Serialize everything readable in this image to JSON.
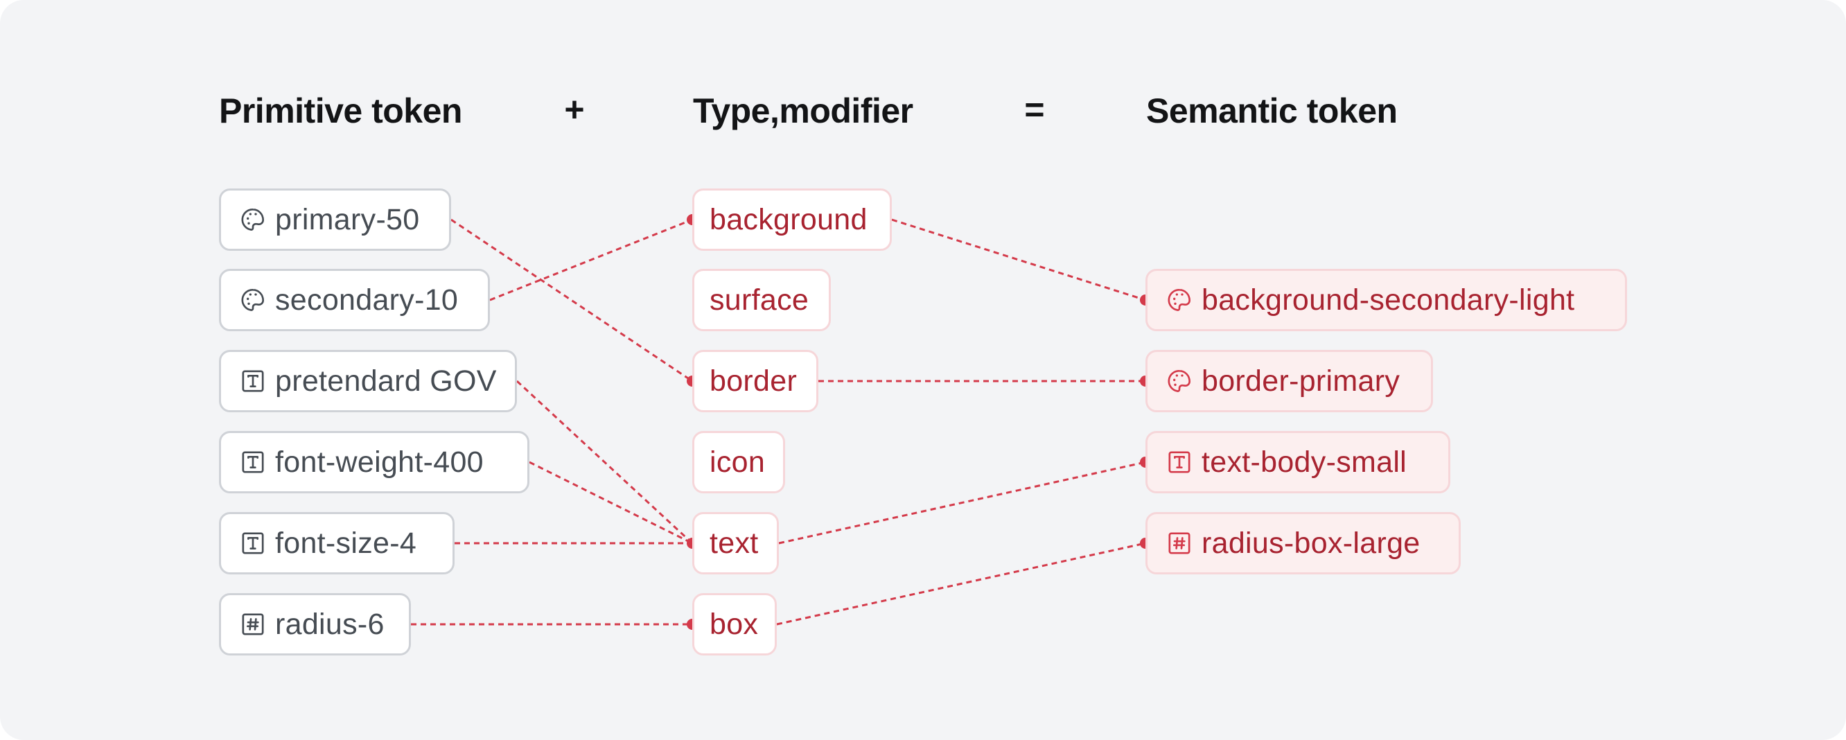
{
  "headers": {
    "primitive": "Primitive token",
    "plus": "+",
    "modifier": "Type,modifier",
    "equals": "=",
    "semantic": "Semantic token"
  },
  "colors": {
    "background": "#f3f4f6",
    "accent": "#d43a4a",
    "accent_text": "#a82330",
    "neutral_text": "#464c53",
    "neutral_border": "#cfd2d7",
    "accent_border": "#f6d6d9",
    "semantic_fill": "#fcefef"
  },
  "primitive_tokens": [
    {
      "id": "primary-50",
      "label": "primary-50",
      "icon": "palette-icon"
    },
    {
      "id": "secondary-10",
      "label": "secondary-10",
      "icon": "palette-icon"
    },
    {
      "id": "pretendard-gov",
      "label": "pretendard GOV",
      "icon": "text-type-icon"
    },
    {
      "id": "font-weight-400",
      "label": "font-weight-400",
      "icon": "text-type-icon"
    },
    {
      "id": "font-size-4",
      "label": "font-size-4",
      "icon": "text-type-icon"
    },
    {
      "id": "radius-6",
      "label": "radius-6",
      "icon": "number-hash-icon"
    }
  ],
  "modifiers": [
    {
      "id": "background",
      "label": "background"
    },
    {
      "id": "surface",
      "label": "surface"
    },
    {
      "id": "border",
      "label": "border"
    },
    {
      "id": "icon",
      "label": "icon"
    },
    {
      "id": "text",
      "label": "text"
    },
    {
      "id": "box",
      "label": "box"
    }
  ],
  "semantic_tokens": [
    {
      "id": "background-secondary-light",
      "label": "background-secondary-light",
      "icon": "palette-icon"
    },
    {
      "id": "border-primary",
      "label": "border-primary",
      "icon": "palette-icon"
    },
    {
      "id": "text-body-small",
      "label": "text-body-small",
      "icon": "text-type-icon"
    },
    {
      "id": "radius-box-large",
      "label": "radius-box-large",
      "icon": "number-hash-icon"
    }
  ],
  "connections": [
    {
      "from": "primary-50",
      "to": "border"
    },
    {
      "from": "secondary-10",
      "to": "background"
    },
    {
      "from": "pretendard-gov",
      "to": "text"
    },
    {
      "from": "font-weight-400",
      "to": "text"
    },
    {
      "from": "font-size-4",
      "to": "text"
    },
    {
      "from": "radius-6",
      "to": "box"
    },
    {
      "from": "background",
      "to": "background-secondary-light"
    },
    {
      "from": "border",
      "to": "border-primary"
    },
    {
      "from": "text",
      "to": "text-body-small"
    },
    {
      "from": "box",
      "to": "radius-box-large"
    }
  ]
}
